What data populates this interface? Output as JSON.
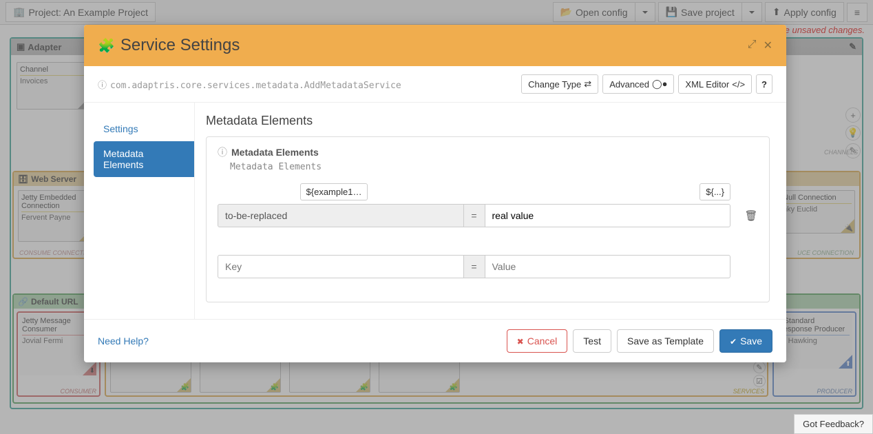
{
  "toolbar": {
    "project_label": "Project: An Example Project",
    "open_config": "Open config",
    "save_project": "Save project",
    "apply_config": "Apply config"
  },
  "unsaved_msg": "You have unsaved changes.",
  "bg": {
    "adapter_header": "Adapter",
    "channel": {
      "title": "Channel",
      "body": "Invoices"
    },
    "web_server_header": "Web Server",
    "jetty_conn_title": "Jetty Embedded Connection",
    "jetty_conn_body": "Fervent Payne",
    "null_conn_title": "Null Connection",
    "null_conn_body": "nky Euclid",
    "consume_conn_label": "CONSUME CONNECTION",
    "produce_conn_label": "UCE CONNECTION",
    "default_url_header": "Default URL",
    "jetty_msg_title": "Jetty Message Consumer",
    "jetty_msg_body": "Jovial Fermi",
    "std_resp_title": "y Standard Response Producer",
    "std_resp_body": "nk Hawking",
    "consumer_label": "CONSUMER",
    "producer_label": "PRODUCER",
    "services_label": "SERVICES",
    "channels_label": "CHANNELS"
  },
  "modal": {
    "title": "Service Settings",
    "class": "com.adaptris.core.services.metadata.AddMetadataService",
    "change_type": "Change Type",
    "advanced": "Advanced",
    "xml_editor": "XML Editor",
    "tabs": {
      "settings": "Settings",
      "metadata": "Metadata Elements"
    },
    "content_title": "Metadata Elements",
    "panel_title": "Metadata Elements",
    "panel_desc": "Metadata Elements",
    "example_tag": "${example1…",
    "placeholder_tag": "${...}",
    "row1": {
      "key": "to-be-replaced",
      "value": "real value"
    },
    "new_row": {
      "key_ph": "Key",
      "val_ph": "Value"
    },
    "help": "Need Help?",
    "cancel": "Cancel",
    "test": "Test",
    "save_template": "Save as Template",
    "save": "Save"
  },
  "feedback": "Got Feedback?"
}
